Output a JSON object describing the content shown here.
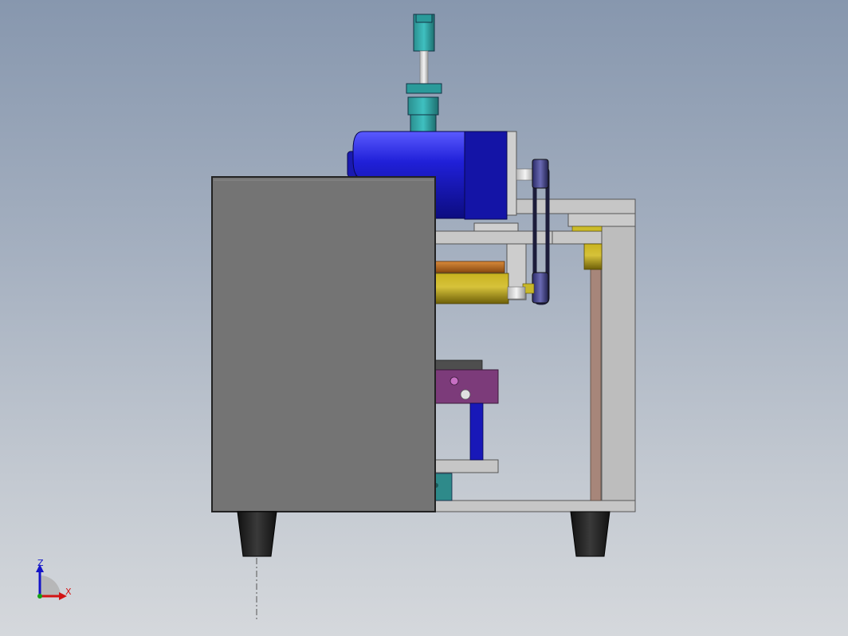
{
  "colors": {
    "background_top": "#8797ae",
    "background_bottom": "#d5d8dc",
    "cover_panel": "#747474",
    "frame": "#c2c2c2",
    "motor": "#1f1fc0",
    "cylinder": "#0f8a8a",
    "roller_yellow": "#b7a51a",
    "roller_orange": "#b8661c",
    "bracket_purple": "#7c3b7a",
    "foot": "#222222",
    "axis_x": "#d21414",
    "axis_y": "#14a014",
    "axis_z": "#1414c8"
  },
  "triad": {
    "z_label": "Z",
    "x_label": "X"
  }
}
